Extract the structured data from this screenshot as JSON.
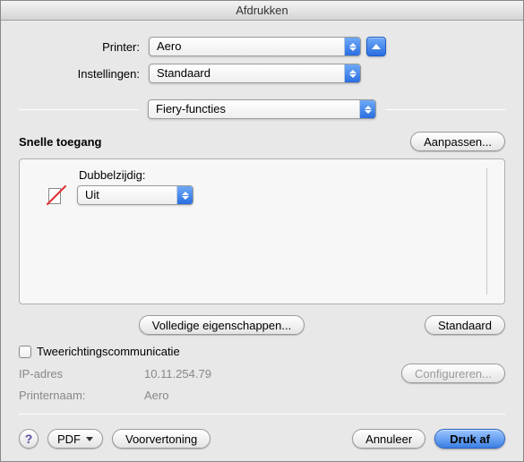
{
  "window": {
    "title": "Afdrukken"
  },
  "labels": {
    "printer": "Printer:",
    "presets": "Instellingen:",
    "pane": "Fiery-functies"
  },
  "printer": {
    "selected": "Aero"
  },
  "presets": {
    "selected": "Standaard"
  },
  "section": {
    "title": "Snelle toegang",
    "customize": "Aanpassen..."
  },
  "duplex": {
    "label": "Dubbelzijdig:",
    "value": "Uit"
  },
  "buttons": {
    "fullprops": "Volledige eigenschappen...",
    "standard": "Standaard",
    "configure": "Configureren...",
    "pdf": "PDF",
    "preview": "Voorvertoning",
    "cancel": "Annuleer",
    "print": "Druk af"
  },
  "twoway": {
    "label": "Tweerichtingscommunicatie"
  },
  "info": {
    "ip_label": "IP-adres",
    "ip_value": "10.11.254.79",
    "printername_label": "Printernaam:",
    "printername_value": "Aero"
  },
  "help": {
    "glyph": "?"
  }
}
